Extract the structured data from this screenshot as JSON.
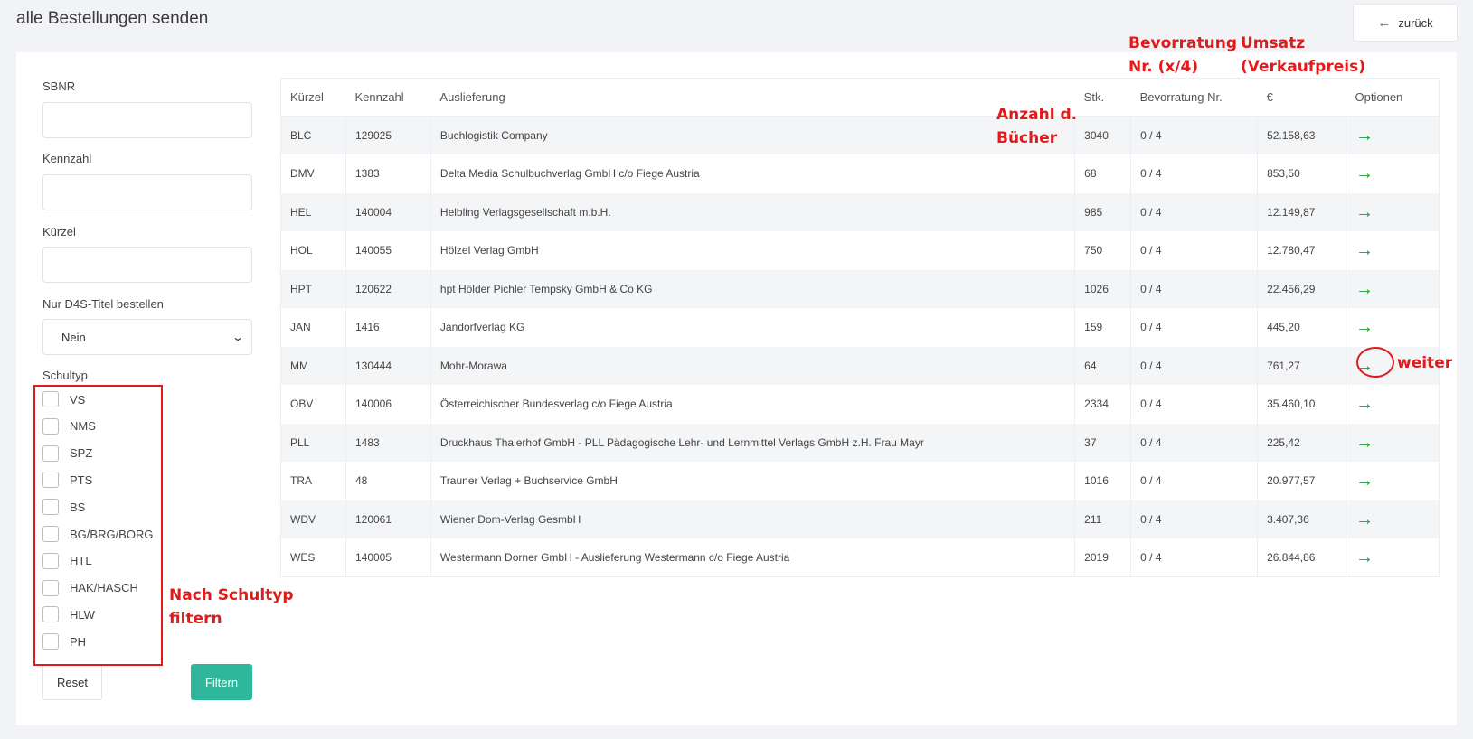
{
  "header": {
    "title": "alle Bestellungen senden",
    "back_label": "zurück"
  },
  "filters": {
    "sbnr_label": "SBNR",
    "kennzahl_label": "Kennzahl",
    "kuerzel_label": "Kürzel",
    "d4s_label": "Nur D4S-Titel bestellen",
    "d4s_value": "Nein",
    "schultyp_label": "Schultyp",
    "schultypen": [
      "VS",
      "NMS",
      "SPZ",
      "PTS",
      "BS",
      "BG/BRG/BORG",
      "HTL",
      "HAK/HASCH",
      "HLW",
      "PH"
    ],
    "reset_label": "Reset",
    "filter_label": "Filtern"
  },
  "table": {
    "headers": [
      "Kürzel",
      "Kennzahl",
      "Auslieferung",
      "Stk.",
      "Bevorratung Nr.",
      "€",
      "Optionen"
    ],
    "rows": [
      [
        "BLC",
        "129025",
        "Buchlogistik Company",
        "3040",
        "0 / 4",
        "52.158,63"
      ],
      [
        "DMV",
        "1383",
        "Delta Media Schulbuchverlag GmbH c/o Fiege Austria",
        "68",
        "0 / 4",
        "853,50"
      ],
      [
        "HEL",
        "140004",
        "Helbling Verlagsgesellschaft m.b.H.",
        "985",
        "0 / 4",
        "12.149,87"
      ],
      [
        "HOL",
        "140055",
        "Hölzel Verlag GmbH",
        "750",
        "0 / 4",
        "12.780,47"
      ],
      [
        "HPT",
        "120622",
        "hpt Hölder Pichler Tempsky GmbH & Co KG",
        "1026",
        "0 / 4",
        "22.456,29"
      ],
      [
        "JAN",
        "1416",
        "Jandorfverlag KG",
        "159",
        "0 / 4",
        "445,20"
      ],
      [
        "MM",
        "130444",
        "Mohr-Morawa",
        "64",
        "0 / 4",
        "761,27"
      ],
      [
        "OBV",
        "140006",
        "Österreichischer Bundesverlag c/o Fiege Austria",
        "2334",
        "0 / 4",
        "35.460,10"
      ],
      [
        "PLL",
        "1483",
        "Druckhaus Thalerhof GmbH - PLL Pädagogische Lehr- und Lernmittel Verlags GmbH z.H. Frau Mayr",
        "37",
        "0 / 4",
        "225,42"
      ],
      [
        "TRA",
        "48",
        "Trauner Verlag + Buchservice GmbH",
        "1016",
        "0 / 4",
        "20.977,57"
      ],
      [
        "WDV",
        "120061",
        "Wiener Dom-Verlag GesmbH",
        "211",
        "0 / 4",
        "3.407,36"
      ],
      [
        "WES",
        "140005",
        "Westermann Dorner GmbH - Auslieferung Westermann c/o Fiege Austria",
        "2019",
        "0 / 4",
        "26.844,86"
      ]
    ],
    "option_icon": "arrow-right-icon"
  },
  "annotations": {
    "bevorratung_1": "Bevorratung",
    "bevorratung_2": "Nr. (x/4)",
    "umsatz_1": "Umsatz",
    "umsatz_2": "(Verkaufpreis)",
    "anzahl_1": "Anzahl d.",
    "anzahl_2": "Bücher",
    "weiter": "weiter",
    "schultyp_1": "Nach Schultyp",
    "schultyp_2": "filtern",
    "color": "#e01b1b"
  },
  "colors": {
    "accent": "#2eb79a",
    "arrow": "#1f9a3a"
  }
}
